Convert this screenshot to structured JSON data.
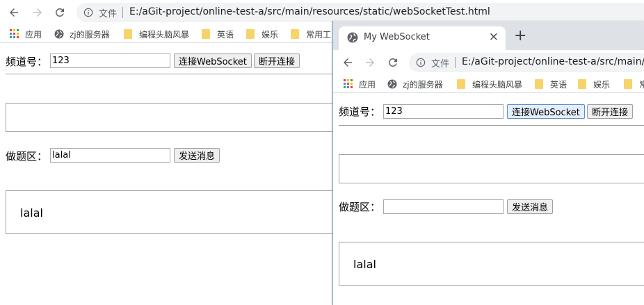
{
  "window_back": {
    "file_label": "文件",
    "url": "E:/aGit-project/online-test-a/src/main/resources/static/webSocketTest.html",
    "channel_label": "频道号：",
    "channel_value": "123",
    "connect_label": "连接WebSocket",
    "disconnect_label": "断开连接",
    "answer_label": "做题区：",
    "answer_value": "lalal",
    "send_label": "发送消息",
    "message_text": "lalal"
  },
  "window_front": {
    "tab_title": "My WebSocket",
    "tab_close": "×",
    "new_tab": "+",
    "file_label": "文件",
    "url": "E:/aGit-project/online-test-a/src/main/",
    "channel_label": "频道号：",
    "channel_value": "123",
    "connect_label": "连接WebSocket",
    "disconnect_label": "断开连接",
    "answer_label": "做题区：",
    "answer_value": "",
    "send_label": "发送消息",
    "message_text": "lalal"
  },
  "bookmarks": {
    "apps": "应用",
    "zj_server": "zj的服务器",
    "brainstorm": "编程头脑风暴",
    "english": "英语",
    "entertainment": "娱乐",
    "tools_back": "常用工",
    "tools_front": "常"
  },
  "colors": {
    "folder": "#f7d46b",
    "tabstrip": "#dee1e6",
    "omnibox": "#f1f3f4"
  },
  "icons": {
    "back": "arrow-left-icon",
    "forward": "arrow-right-icon",
    "reload": "reload-icon",
    "info": "info-icon",
    "globe": "globe-icon",
    "apps": "apps-grid-icon",
    "folder": "folder-icon"
  }
}
